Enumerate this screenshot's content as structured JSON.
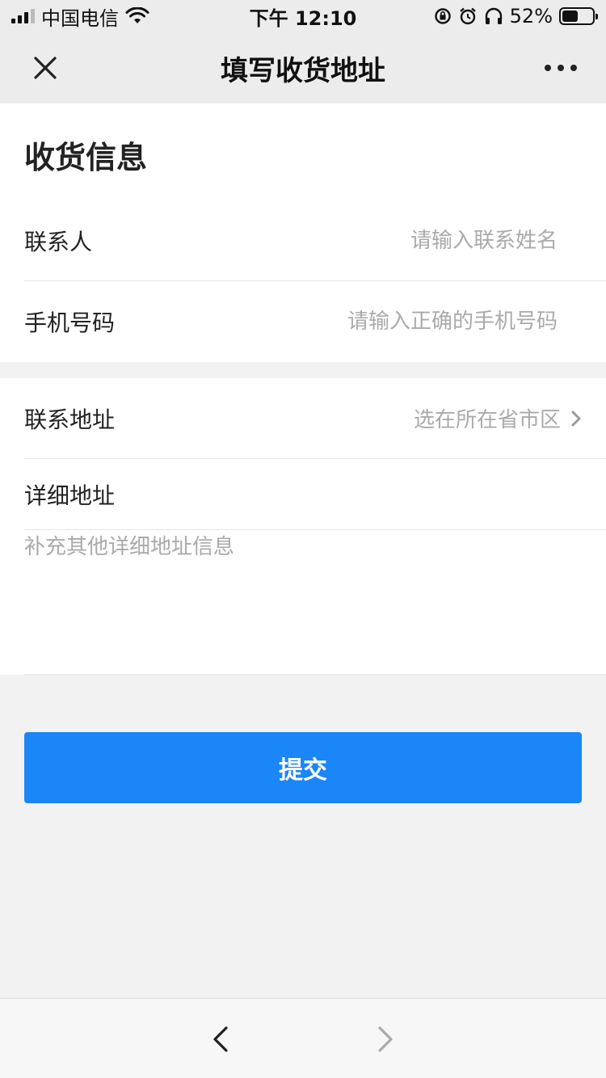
{
  "status_bar": {
    "carrier": "中国电信",
    "time": "下午 12:10",
    "battery": "52%",
    "battery_level": 0.52
  },
  "nav": {
    "title": "填写收货地址",
    "close_icon": "close-icon",
    "more_icon": "more-icon"
  },
  "form": {
    "section_title": "收货信息",
    "contact": {
      "label": "联系人",
      "placeholder": "请输入联系姓名"
    },
    "phone": {
      "label": "手机号码",
      "placeholder": "请输入正确的手机号码"
    },
    "address": {
      "label": "联系地址",
      "placeholder": "选在所在省市区"
    },
    "detail": {
      "label": "详细地址",
      "placeholder": "补充其他详细地址信息"
    }
  },
  "submit": {
    "label": "提交",
    "color": "#1a86f8"
  },
  "bottom_bar": {
    "back_icon": "chevron-left-icon",
    "forward_icon": "chevron-right-icon"
  }
}
